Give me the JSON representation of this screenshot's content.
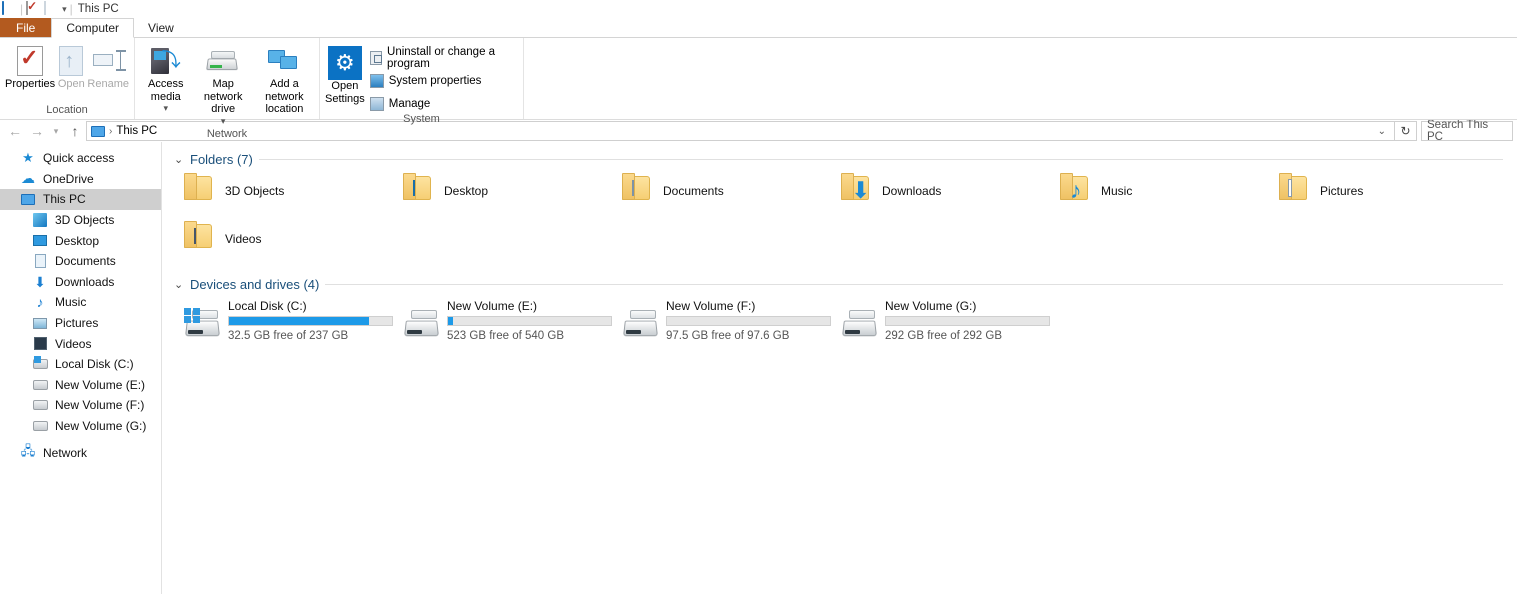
{
  "titlebar": {
    "icons": [
      "computer-icon",
      "properties-quick-icon",
      "blank-page-icon",
      "customize-dropdown-icon"
    ],
    "title": "This PC"
  },
  "tabs": [
    {
      "label": "File",
      "kind": "file"
    },
    {
      "label": "Computer",
      "kind": "active"
    },
    {
      "label": "View",
      "kind": "normal"
    }
  ],
  "ribbon": {
    "groups": [
      {
        "label": "Location",
        "buttons": [
          {
            "label": "Properties",
            "icon": "properties-icon",
            "enabled": true
          },
          {
            "label": "Open",
            "icon": "open-icon",
            "enabled": false
          },
          {
            "label": "Rename",
            "icon": "rename-icon",
            "enabled": false
          }
        ]
      },
      {
        "label": "Network",
        "buttons": [
          {
            "label": "Access media",
            "icon": "access-media-icon",
            "enabled": true,
            "dropdown": true
          },
          {
            "label": "Map network drive",
            "icon": "map-network-drive-icon",
            "enabled": true,
            "dropdown": true
          },
          {
            "label": "Add a network location",
            "icon": "add-network-location-icon",
            "enabled": true,
            "dropdown": false
          }
        ]
      },
      {
        "label": "System",
        "big_button": {
          "label_line1": "Open",
          "label_line2": "Settings",
          "icon": "gear-icon"
        },
        "items": [
          {
            "label": "Uninstall or change a program",
            "icon": "uninstall-program-icon"
          },
          {
            "label": "System properties",
            "icon": "system-properties-icon"
          },
          {
            "label": "Manage",
            "icon": "manage-icon"
          }
        ]
      }
    ]
  },
  "addressbar": {
    "back_icon": "back-arrow-icon",
    "forward_icon": "forward-arrow-icon",
    "recent_icon": "recent-locations-icon",
    "up_icon": "up-arrow-icon",
    "path_icon": "computer-icon",
    "separator": "›",
    "path": "This PC",
    "dropdown_icon": "chevron-down-icon",
    "refresh_icon": "refresh-icon",
    "search_placeholder": "Search This PC"
  },
  "navpane": {
    "items": [
      {
        "label": "Quick access",
        "icon": "star-icon",
        "level": 0,
        "selected": false
      },
      {
        "label": "OneDrive",
        "icon": "cloud-icon",
        "level": 0,
        "selected": false
      },
      {
        "label": "This PC",
        "icon": "computer-icon",
        "level": 0,
        "selected": true
      },
      {
        "label": "3D Objects",
        "icon": "cube-icon",
        "level": 1,
        "selected": false
      },
      {
        "label": "Desktop",
        "icon": "desktop-icon",
        "level": 1,
        "selected": false
      },
      {
        "label": "Documents",
        "icon": "document-icon",
        "level": 1,
        "selected": false
      },
      {
        "label": "Downloads",
        "icon": "download-icon",
        "level": 1,
        "selected": false
      },
      {
        "label": "Music",
        "icon": "music-icon",
        "level": 1,
        "selected": false
      },
      {
        "label": "Pictures",
        "icon": "picture-icon",
        "level": 1,
        "selected": false
      },
      {
        "label": "Videos",
        "icon": "video-icon",
        "level": 1,
        "selected": false
      },
      {
        "label": "Local Disk (C:)",
        "icon": "windows-drive-icon",
        "level": 1,
        "selected": false
      },
      {
        "label": "New Volume (E:)",
        "icon": "drive-icon",
        "level": 1,
        "selected": false
      },
      {
        "label": "New Volume (F:)",
        "icon": "drive-icon",
        "level": 1,
        "selected": false
      },
      {
        "label": "New Volume (G:)",
        "icon": "drive-icon",
        "level": 1,
        "selected": false
      },
      {
        "label": "Network",
        "icon": "network-icon",
        "level": 0,
        "selected": false
      }
    ]
  },
  "content": {
    "folders_section": {
      "chevron": "⌄",
      "title": "Folders (7)",
      "items": [
        {
          "label": "3D Objects",
          "icon": "folder-3d-objects-icon"
        },
        {
          "label": "Desktop",
          "icon": "folder-desktop-icon"
        },
        {
          "label": "Documents",
          "icon": "folder-documents-icon"
        },
        {
          "label": "Downloads",
          "icon": "folder-downloads-icon"
        },
        {
          "label": "Music",
          "icon": "folder-music-icon"
        },
        {
          "label": "Pictures",
          "icon": "folder-pictures-icon"
        },
        {
          "label": "Videos",
          "icon": "folder-videos-icon"
        }
      ]
    },
    "drives_section": {
      "chevron": "⌄",
      "title": "Devices and drives (4)",
      "items": [
        {
          "label": "Local Disk (C:)",
          "icon": "windows-drive-icon",
          "free_text": "32.5 GB free of 237 GB",
          "used_percent": 86
        },
        {
          "label": "New Volume (E:)",
          "icon": "drive-icon",
          "free_text": "523 GB free of 540 GB",
          "used_percent": 3
        },
        {
          "label": "New Volume (F:)",
          "icon": "drive-icon",
          "free_text": "97.5 GB free of 97.6 GB",
          "used_percent": 0
        },
        {
          "label": "New Volume (G:)",
          "icon": "drive-icon",
          "free_text": "292 GB free of 292 GB",
          "used_percent": 0
        }
      ]
    }
  },
  "colors": {
    "accent_blue": "#1d9ae8",
    "file_tab": "#b35a1f",
    "selection_gray": "#cfcfcf",
    "section_title": "#1a4f7a",
    "folder_yellow": "#f6cf74"
  }
}
